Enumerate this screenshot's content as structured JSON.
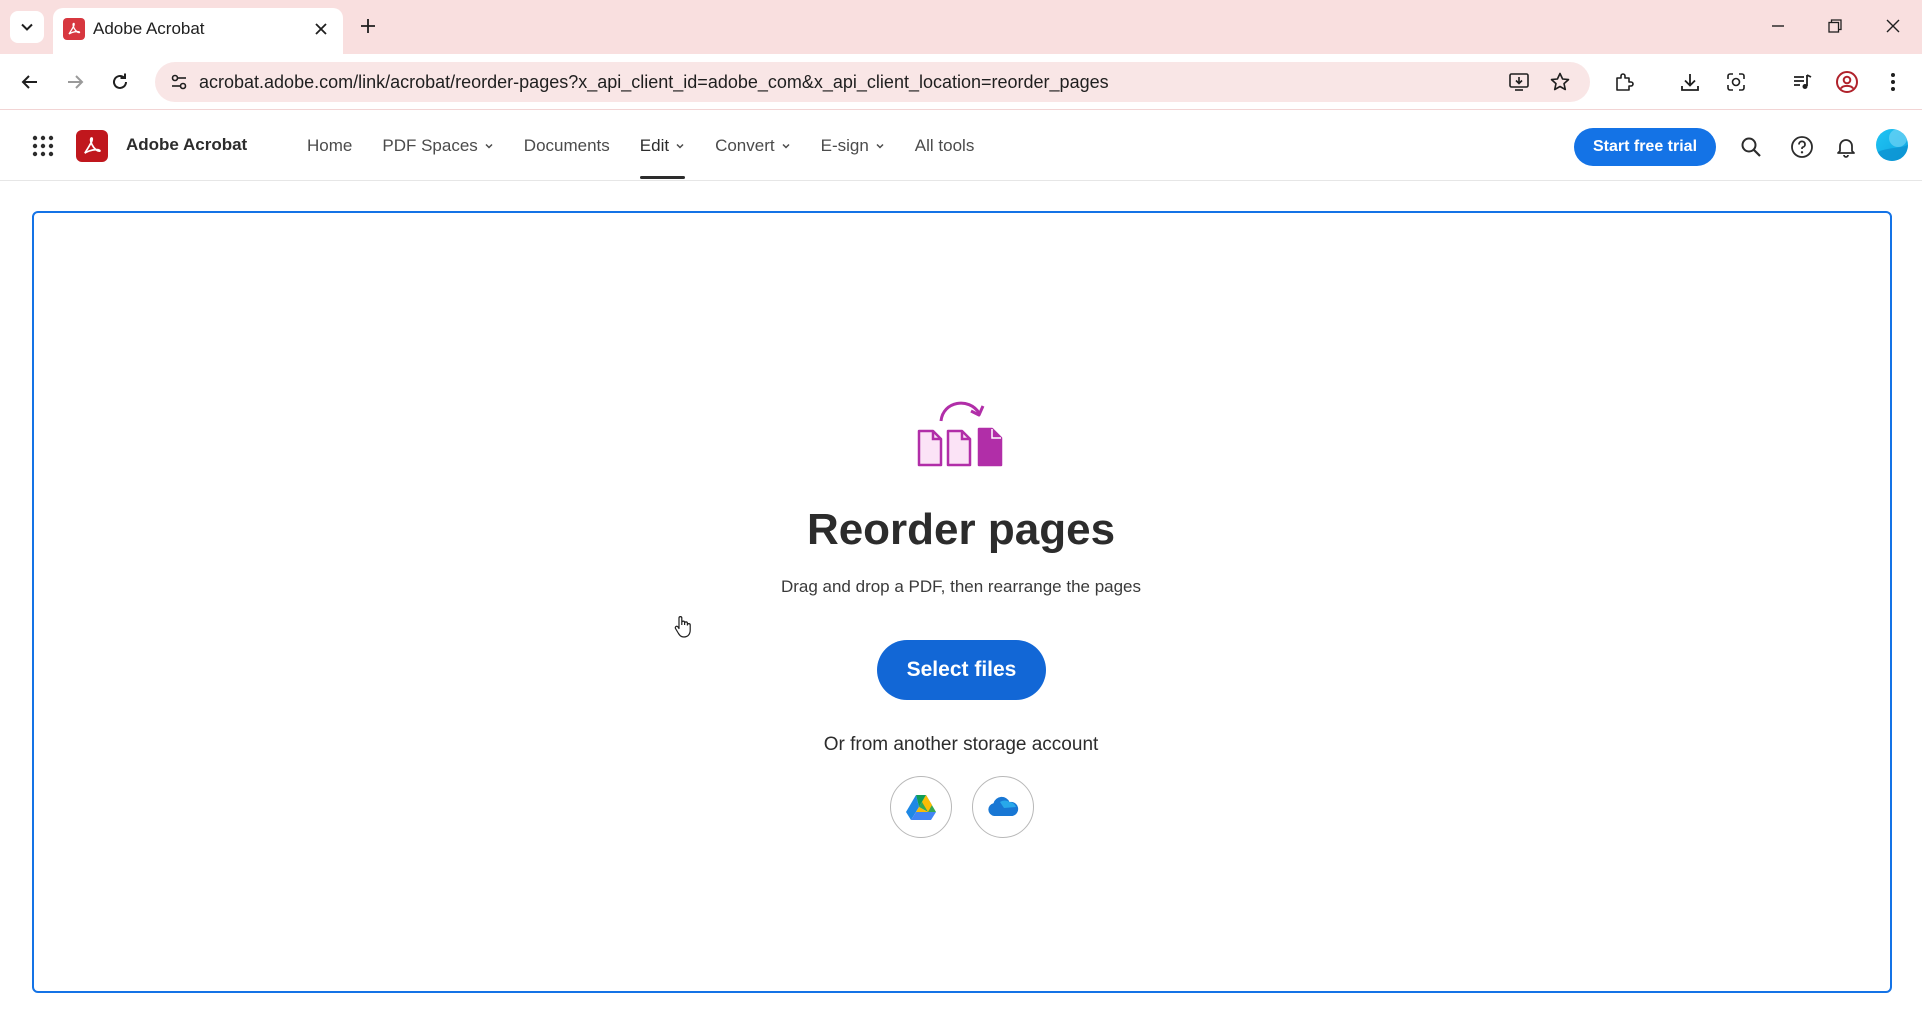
{
  "browser": {
    "tab_title": "Adobe Acrobat",
    "url": "acrobat.adobe.com/link/acrobat/reorder-pages?x_api_client_id=adobe_com&x_api_client_location=reorder_pages"
  },
  "header": {
    "brand": "Adobe Acrobat",
    "nav": [
      {
        "label": "Home",
        "has_menu": false
      },
      {
        "label": "PDF Spaces",
        "has_menu": true
      },
      {
        "label": "Documents",
        "has_menu": false
      },
      {
        "label": "Edit",
        "has_menu": true,
        "active": true
      },
      {
        "label": "Convert",
        "has_menu": true
      },
      {
        "label": "E-sign",
        "has_menu": true
      },
      {
        "label": "All tools",
        "has_menu": false
      }
    ],
    "trial_label": "Start free trial"
  },
  "main": {
    "title": "Reorder pages",
    "subtitle": "Drag and drop a PDF, then rearrange the pages",
    "select_label": "Select files",
    "storage_label": "Or from another storage account",
    "storage_providers": [
      "google-drive-icon",
      "onedrive-icon"
    ]
  },
  "colors": {
    "accent": "#1473e6",
    "acrobat_red": "#c0171d",
    "tab_strip": "#f9dfdf",
    "reorder_magenta": "#b12ea8"
  }
}
